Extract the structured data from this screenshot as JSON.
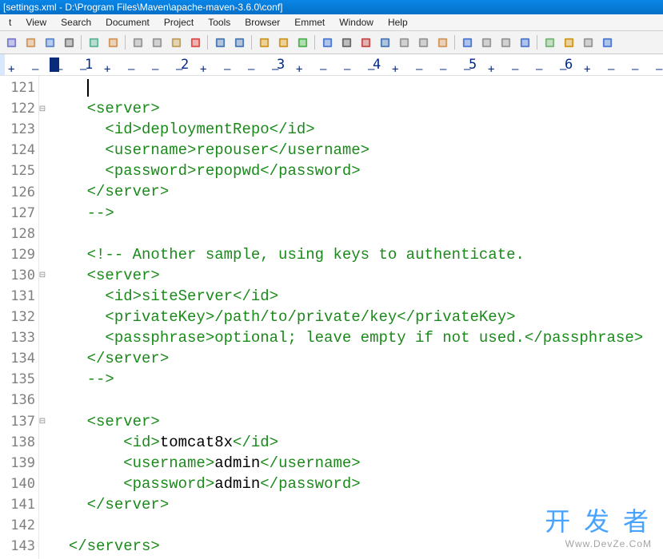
{
  "title": "[settings.xml - D:\\Program Files\\Maven\\apache-maven-3.6.0\\conf]",
  "menus": [
    "t",
    "View",
    "Search",
    "Document",
    "Project",
    "Tools",
    "Browser",
    "Emmet",
    "Window",
    "Help"
  ],
  "toolbar_icons": [
    "new-file",
    "open",
    "save",
    "print",
    "preview",
    "open-folder",
    "cut",
    "copy",
    "paste",
    "delete",
    "undo",
    "redo",
    "search",
    "replace",
    "spellcheck",
    "bookmark",
    "word-wrap",
    "font",
    "hex",
    "show-tabs",
    "show-eol",
    "grid-a",
    "grid-b",
    "grid-c",
    "grid-d",
    "split-a",
    "split-b",
    "split-c",
    "split-d",
    "help"
  ],
  "ruler_numbers": [
    1,
    2,
    3,
    4,
    5,
    6
  ],
  "lines": [
    {
      "n": 121,
      "fold": "",
      "seg": [
        {
          "c": "xml-text",
          "t": "    "
        }
      ],
      "cursor": true
    },
    {
      "n": 122,
      "fold": "⊟",
      "seg": [
        {
          "c": "xml-tag",
          "t": "    <server>"
        }
      ]
    },
    {
      "n": 123,
      "fold": "",
      "seg": [
        {
          "c": "xml-tag",
          "t": "      <id>"
        },
        {
          "c": "xml-comment",
          "t": "deploymentRepo"
        },
        {
          "c": "xml-tag",
          "t": "</id>"
        }
      ]
    },
    {
      "n": 124,
      "fold": "",
      "seg": [
        {
          "c": "xml-tag",
          "t": "      <username>"
        },
        {
          "c": "xml-comment",
          "t": "repouser"
        },
        {
          "c": "xml-tag",
          "t": "</username>"
        }
      ]
    },
    {
      "n": 125,
      "fold": "",
      "seg": [
        {
          "c": "xml-tag",
          "t": "      <password>"
        },
        {
          "c": "xml-comment",
          "t": "repopwd"
        },
        {
          "c": "xml-tag",
          "t": "</password>"
        }
      ]
    },
    {
      "n": 126,
      "fold": "",
      "seg": [
        {
          "c": "xml-tag",
          "t": "    </server>"
        }
      ]
    },
    {
      "n": 127,
      "fold": "",
      "seg": [
        {
          "c": "xml-comment",
          "t": "    -->"
        }
      ]
    },
    {
      "n": 128,
      "fold": "",
      "seg": []
    },
    {
      "n": 129,
      "fold": "",
      "seg": [
        {
          "c": "xml-comment",
          "t": "    <!-- Another sample, using keys to authenticate."
        }
      ]
    },
    {
      "n": 130,
      "fold": "⊟",
      "seg": [
        {
          "c": "xml-tag",
          "t": "    <server>"
        }
      ]
    },
    {
      "n": 131,
      "fold": "",
      "seg": [
        {
          "c": "xml-tag",
          "t": "      <id>"
        },
        {
          "c": "xml-comment",
          "t": "siteServer"
        },
        {
          "c": "xml-tag",
          "t": "</id>"
        }
      ]
    },
    {
      "n": 132,
      "fold": "",
      "seg": [
        {
          "c": "xml-tag",
          "t": "      <privateKey>"
        },
        {
          "c": "xml-comment",
          "t": "/path/to/private/key"
        },
        {
          "c": "xml-tag",
          "t": "</privateKey>"
        }
      ]
    },
    {
      "n": 133,
      "fold": "",
      "seg": [
        {
          "c": "xml-tag",
          "t": "      <passphrase>"
        },
        {
          "c": "xml-comment",
          "t": "optional; leave empty if not used."
        },
        {
          "c": "xml-tag",
          "t": "</passphrase>"
        }
      ]
    },
    {
      "n": 134,
      "fold": "",
      "seg": [
        {
          "c": "xml-tag",
          "t": "    </server>"
        }
      ]
    },
    {
      "n": 135,
      "fold": "",
      "seg": [
        {
          "c": "xml-comment",
          "t": "    -->"
        }
      ]
    },
    {
      "n": 136,
      "fold": "",
      "seg": []
    },
    {
      "n": 137,
      "fold": "⊟",
      "seg": [
        {
          "c": "xml-text",
          "t": "    "
        },
        {
          "c": "xml-tag",
          "t": "<server>"
        }
      ]
    },
    {
      "n": 138,
      "fold": "",
      "seg": [
        {
          "c": "xml-text",
          "t": "        "
        },
        {
          "c": "xml-tag",
          "t": "<id>"
        },
        {
          "c": "xml-text",
          "t": "tomcat8x"
        },
        {
          "c": "xml-tag",
          "t": "</id>"
        }
      ]
    },
    {
      "n": 139,
      "fold": "",
      "seg": [
        {
          "c": "xml-text",
          "t": "        "
        },
        {
          "c": "xml-tag",
          "t": "<username>"
        },
        {
          "c": "xml-text",
          "t": "admin"
        },
        {
          "c": "xml-tag",
          "t": "</username>"
        }
      ]
    },
    {
      "n": 140,
      "fold": "",
      "seg": [
        {
          "c": "xml-text",
          "t": "        "
        },
        {
          "c": "xml-tag",
          "t": "<password>"
        },
        {
          "c": "xml-text",
          "t": "admin"
        },
        {
          "c": "xml-tag",
          "t": "</password>"
        }
      ]
    },
    {
      "n": 141,
      "fold": "",
      "seg": [
        {
          "c": "xml-text",
          "t": "    "
        },
        {
          "c": "xml-tag",
          "t": "</server>"
        }
      ]
    },
    {
      "n": 142,
      "fold": "",
      "seg": []
    },
    {
      "n": 143,
      "fold": "",
      "seg": [
        {
          "c": "xml-text",
          "t": "  "
        },
        {
          "c": "xml-tag",
          "t": "</servers>"
        }
      ]
    }
  ],
  "watermark": {
    "big": "开 发 者",
    "sub": "Www.DevZe.CoM"
  }
}
